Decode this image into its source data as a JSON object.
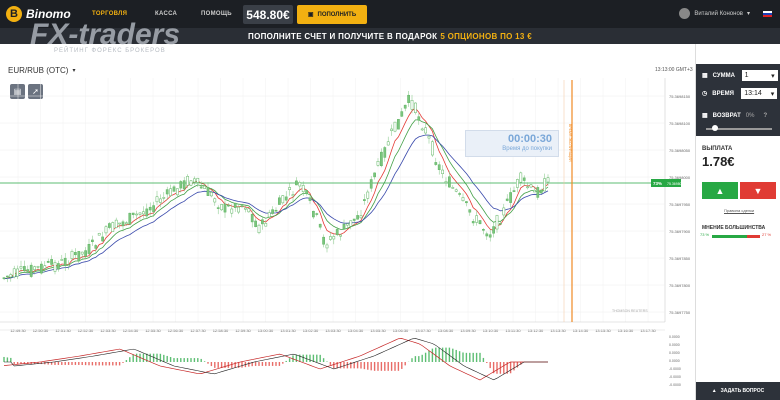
{
  "header": {
    "brand": "Binomo",
    "nav": [
      "ТОРГОВЛЯ",
      "КАССА",
      "ПОМОЩЬ"
    ],
    "balance": "548.80€",
    "deposit_label": "ПОПОЛНИТЬ",
    "user_name": "Виталий Кононов"
  },
  "promo": {
    "text_before": "ПОПОЛНИТЕ СЧЕТ И ПОЛУЧИТЕ В ПОДАРОК",
    "highlight": "5 ОПЦИОНОВ ПО 13 €"
  },
  "watermark": {
    "main": "FX-traders",
    "sub": "РЕЙТИНГ ФОРЕКС БРОКЕРОВ"
  },
  "chart": {
    "asset": "EUR/RUB (OTC)",
    "server_time": "13:13:00 GMT+3",
    "timer_value": "00:00:30",
    "timer_label": "Время до покупки",
    "expiry_label": "ВРЕМЯ ЭКСПИРАЦИИ",
    "current_price_badge": "73%",
    "current_price": "75.3698080",
    "credit": "THOMSON REUTERS",
    "y_ticks": [
      "75.3698150",
      "75.3698100",
      "75.3698050",
      "75.3698000",
      "75.3697950",
      "75.3697900",
      "75.3697850",
      "75.3697800",
      "75.3697750"
    ],
    "x_ticks": [
      "12:49:30",
      "12:50:30",
      "12:51:30",
      "12:52:30",
      "12:53:30",
      "12:54:30",
      "12:55:30",
      "12:56:30",
      "12:57:30",
      "12:58:30",
      "12:59:30",
      "13:00:30",
      "13:01:30",
      "13:02:30",
      "13:03:30",
      "13:04:30",
      "13:05:30",
      "13:06:30",
      "13:07:30",
      "13:08:30",
      "13:09:30",
      "13:10:30",
      "13:11:30",
      "13:12:30",
      "13:13:30",
      "13:14:30",
      "13:15:30",
      "13:16:30",
      "13:17:30"
    ],
    "macd_ticks": [
      "0.0000",
      "0.0000",
      "0.0000",
      "0.0000",
      "-0.0000",
      "-0.0000",
      "-0.0000"
    ]
  },
  "sidebar": {
    "amount_label": "СУММА",
    "amount_value": "1",
    "time_label": "ВРЕМЯ",
    "time_value": "13:14",
    "refund_label": "ВОЗВРАТ",
    "refund_value": "0%",
    "payout_label": "ВЫПЛАТА",
    "payout_value": "1.78€",
    "rules_link": "Правила сделки",
    "majority_label": "МНЕНИЕ БОЛЬШИНСТВА",
    "majority_up": "73 %",
    "majority_down": "27 %",
    "majority_up_fraction": 0.73,
    "ask_label": "ЗАДАТЬ ВОПРОС"
  },
  "colors": {
    "up": "#27a844",
    "down": "#e03b34",
    "accent": "#f2b011",
    "expiry": "#f08a24"
  }
}
